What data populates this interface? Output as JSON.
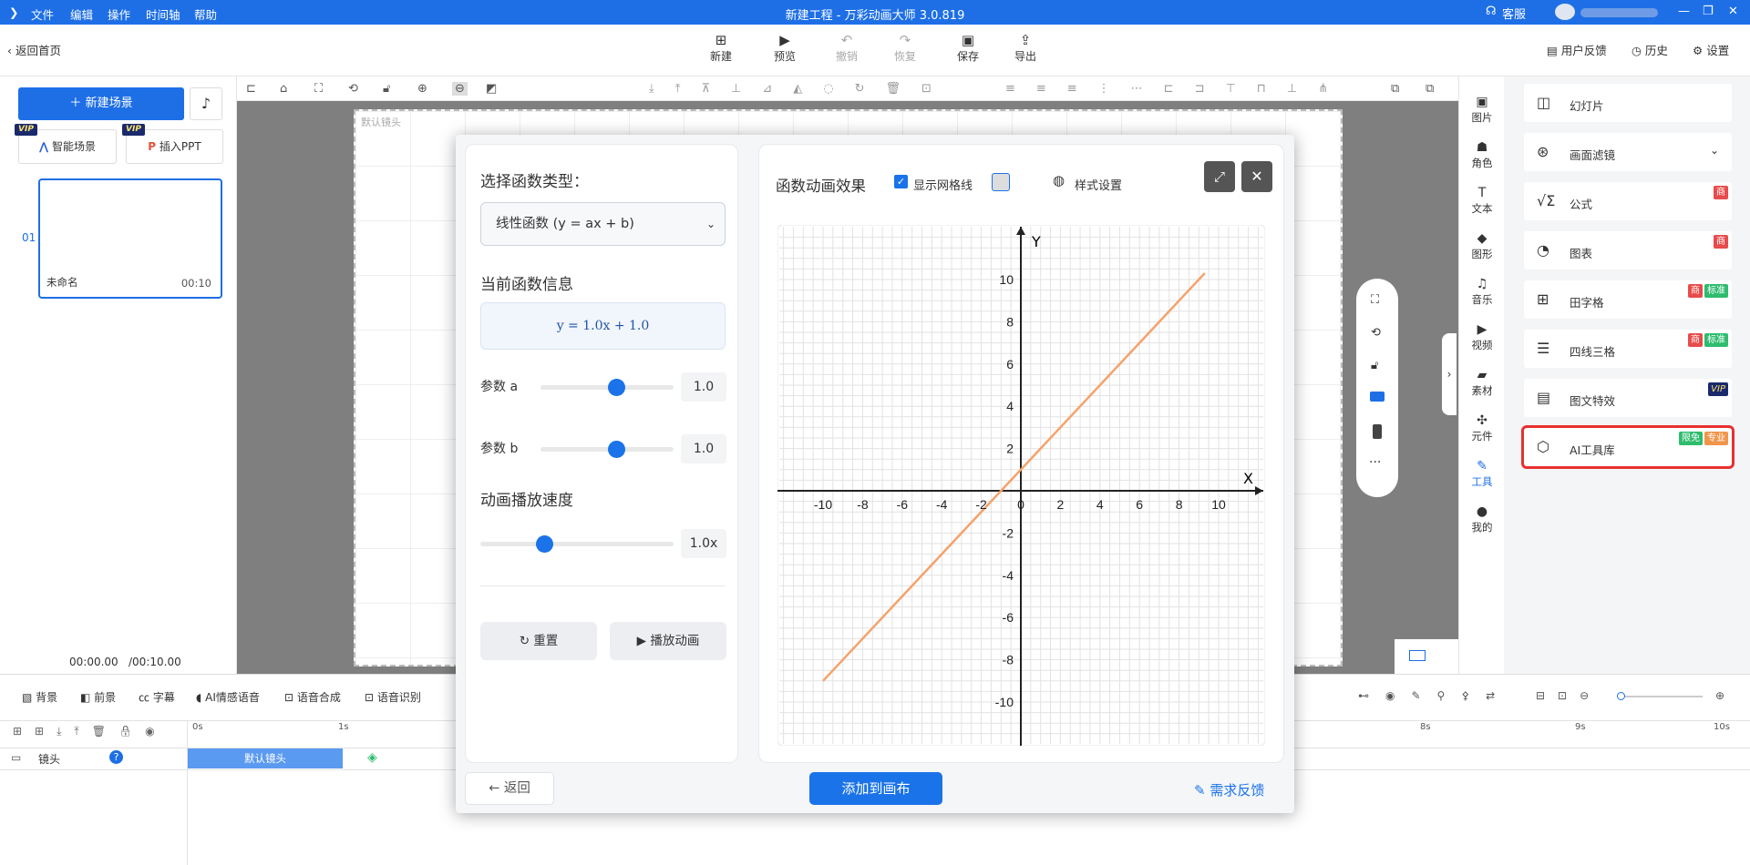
{
  "titlebar": {
    "menu": [
      "文件",
      "编辑",
      "操作",
      "时间轴",
      "帮助"
    ],
    "title": "新建工程 - 万彩动画大师 3.0.819",
    "service": "客服"
  },
  "toolbar": {
    "back": "返回首页",
    "items": [
      {
        "label": "新建",
        "icon": "plus"
      },
      {
        "label": "预览",
        "icon": "play"
      },
      {
        "label": "撤销",
        "icon": "undo"
      },
      {
        "label": "恢复",
        "icon": "redo"
      },
      {
        "label": "保存",
        "icon": "save"
      },
      {
        "label": "导出",
        "icon": "export"
      }
    ],
    "feedback": "用户反馈",
    "history": "历史",
    "settings": "设置"
  },
  "left": {
    "new_scene": "新建场景",
    "ai_scene": "智能场景",
    "insert_ppt": "插入PPT",
    "vip": "VIP",
    "scene": {
      "index": "01",
      "name": "未命名",
      "duration": "00:10"
    },
    "time_current": "00:00.00",
    "time_total": "/00:10.00"
  },
  "canvas": {
    "camera_label": "默认镜头"
  },
  "iconstrip": [
    "图片",
    "角色",
    "文本",
    "图形",
    "音乐",
    "视频",
    "素材",
    "元件",
    "工具",
    "我的"
  ],
  "rightpanel": [
    {
      "label": "幻灯片",
      "icon": "chart-icon",
      "tags": []
    },
    {
      "label": "画面滤镜",
      "icon": "filter-icon",
      "tags": []
    },
    {
      "label": "公式",
      "icon": "formula-icon",
      "tags": [
        "商"
      ]
    },
    {
      "label": "图表",
      "icon": "pie-icon",
      "tags": [
        "商"
      ]
    },
    {
      "label": "田字格",
      "icon": "grid-icon",
      "tags": [
        "商",
        "标准"
      ]
    },
    {
      "label": "四线三格",
      "icon": "lines-icon",
      "tags": [
        "商",
        "标准"
      ]
    },
    {
      "label": "图文特效",
      "icon": "image-text-icon",
      "tags": [
        "VIP"
      ]
    },
    {
      "label": "AI工具库",
      "icon": "ai-icon",
      "tags": [
        "限免",
        "专业"
      ]
    }
  ],
  "timeline": {
    "tools": [
      "背景",
      "前景",
      "字幕",
      "AI情感语音",
      "语音合成",
      "语音识别"
    ],
    "track": "镜头",
    "clip": "默认镜头",
    "ticks": [
      "0s",
      "1s",
      "8s",
      "9s",
      "10s"
    ]
  },
  "dialog": {
    "select_type_label": "选择函数类型：",
    "select_value": "线性函数 (y = ax + b)",
    "info_label": "当前函数信息",
    "formula": "y = 1.0x + 1.0",
    "param_a_label": "参数 a",
    "param_a_value": "1.0",
    "param_b_label": "参数 b",
    "param_b_value": "1.0",
    "speed_label": "动画播放速度",
    "speed_value": "1.0x",
    "reset": "重置",
    "play": "播放动画",
    "back": "返回",
    "add": "添加到画布",
    "feedback": "需求反馈",
    "chart_title": "函数动画效果",
    "grid_label": "显示网格线",
    "style_label": "样式设置"
  },
  "chart_data": {
    "type": "line",
    "function": "y = 1.0x + 1.0",
    "xlim": [
      -10,
      10
    ],
    "ylim": [
      -10,
      10
    ],
    "xlabel": "X",
    "ylabel": "Y",
    "x_ticks": [
      -10,
      -8,
      -6,
      -4,
      -2,
      0,
      2,
      4,
      6,
      8,
      10
    ],
    "y_ticks": [
      -10,
      -8,
      -6,
      -4,
      -2,
      2,
      4,
      6,
      8,
      10
    ],
    "grid": true,
    "series": [
      {
        "x": [
          -10,
          9.3
        ],
        "y": [
          -9,
          10.3
        ],
        "color": "#f5a26b"
      }
    ]
  }
}
